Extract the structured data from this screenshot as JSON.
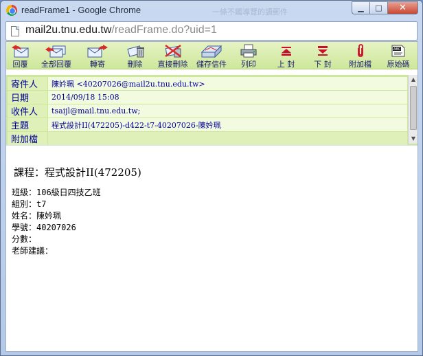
{
  "window": {
    "title": "readFrame1 - Google Chrome",
    "ghost_title": "一條不觸導覽的讀郵件",
    "controls": {
      "minimize": "▁",
      "maximize": "□",
      "close": "✕"
    }
  },
  "address": {
    "host": "mail2u.tnu.edu.tw",
    "path": "/readFrame.do?uid=1"
  },
  "toolbar": {
    "items": [
      {
        "label": "回覆",
        "icon": "reply-icon"
      },
      {
        "label": "全部回覆",
        "icon": "reply-all-icon"
      },
      {
        "label": "轉寄",
        "icon": "forward-icon"
      },
      {
        "label": "刪除",
        "icon": "delete-icon"
      },
      {
        "label": "直接刪除",
        "icon": "delete-permanent-icon"
      },
      {
        "label": "儲存信件",
        "icon": "save-mail-icon"
      },
      {
        "label": "列印",
        "icon": "print-icon"
      },
      {
        "label": "上 封",
        "icon": "previous-mail-icon"
      },
      {
        "label": "下 封",
        "icon": "next-mail-icon"
      },
      {
        "label": "附加檔",
        "icon": "attachment-icon"
      },
      {
        "label": "原始碼",
        "icon": "source-code-icon"
      }
    ]
  },
  "headers": {
    "sender_label": "寄件人",
    "sender_value": "陳妗珮 <40207026@mail2u.tnu.edu.tw>",
    "date_label": "日期",
    "date_value": "2014/09/18 15:08",
    "recipient_label": "收件人",
    "recipient_value": "tsaijl@mail.tnu.edu.tw;",
    "subject_label": "主題",
    "subject_value": "程式設計II(472205)-d422-t7-40207026-陳妗珮",
    "attachment_label": "附加檔",
    "attachment_value": ""
  },
  "body": {
    "course": "課程：程式設計II(472205)",
    "lines": [
      "班級：106級日四技乙班",
      "組別：t7",
      "姓名：陳妗珮",
      "學號：40207026",
      "分數：",
      "老師建議："
    ]
  },
  "colors": {
    "toolbar_bg": "#cde79a",
    "header_label_bg": "#dff0b8",
    "header_value_bg": "#f2fadf",
    "header_text": "#000099",
    "toolbar_text": "#1b1b6e"
  }
}
